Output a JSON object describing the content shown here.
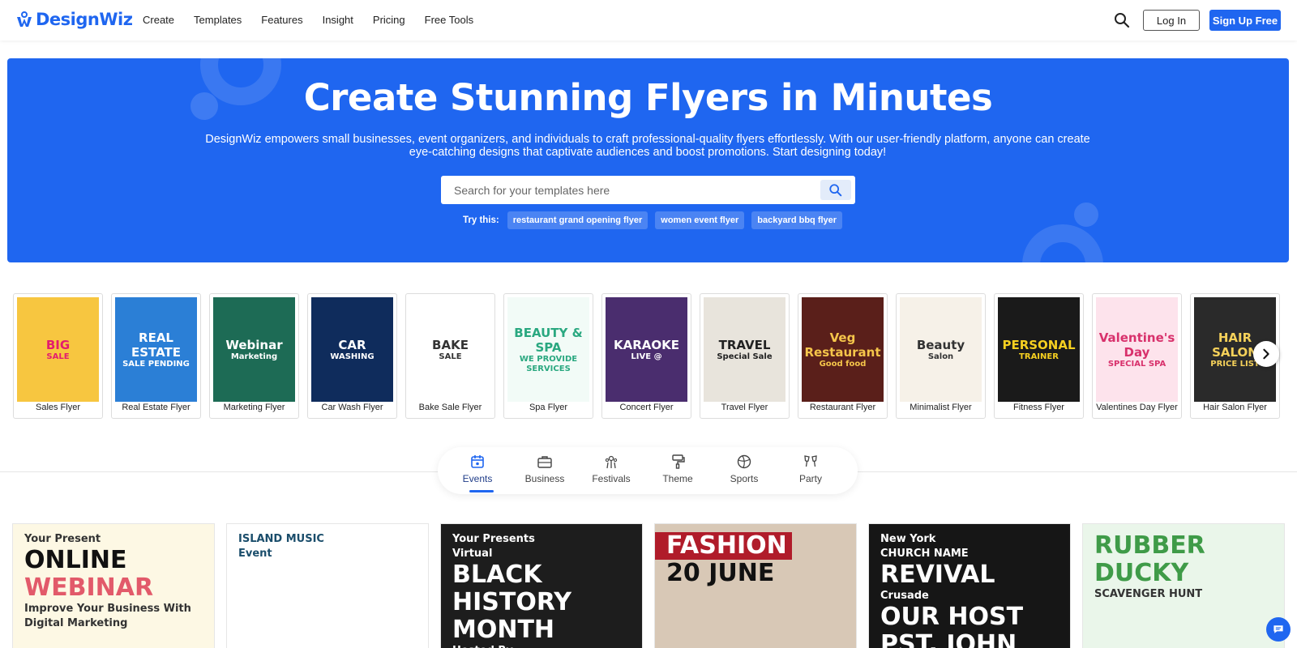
{
  "brand": {
    "name": "DesignWiz"
  },
  "nav": {
    "items": [
      "Create",
      "Templates",
      "Features",
      "Insight",
      "Pricing",
      "Free Tools"
    ],
    "login": "Log In",
    "signup": "Sign Up Free"
  },
  "hero": {
    "title": "Create Stunning Flyers in Minutes",
    "description": "DesignWiz empowers small businesses, event organizers, and individuals to craft professional-quality flyers effortlessly. With our user-friendly platform, anyone can create eye-catching designs that captivate audiences and boost promotions. Start designing today!",
    "search_placeholder": "Search for your templates here",
    "try_label": "Try this:",
    "suggestions": [
      "restaurant grand opening flyer",
      "women event flyer",
      "backyard bbq flyer"
    ]
  },
  "flyer_types": [
    {
      "label": "Sales Flyer",
      "thumb_lines": [
        "BIG",
        "SALE"
      ],
      "bg": "#f7c640",
      "fg": "#e31c6e"
    },
    {
      "label": "Real Estate Flyer",
      "thumb_lines": [
        "REAL ESTATE",
        "SALE PENDING"
      ],
      "bg": "#2b7fd6",
      "fg": "#ffffff"
    },
    {
      "label": "Marketing Flyer",
      "thumb_lines": [
        "Webinar",
        "Marketing"
      ],
      "bg": "#1d6b55",
      "fg": "#ffffff"
    },
    {
      "label": "Car Wash Flyer",
      "thumb_lines": [
        "CAR",
        "WASHING"
      ],
      "bg": "#0f2c5c",
      "fg": "#ffffff"
    },
    {
      "label": "Bake Sale Flyer",
      "thumb_lines": [
        "BAKE",
        "SALE"
      ],
      "bg": "#ffffff",
      "fg": "#333333"
    },
    {
      "label": "Spa Flyer",
      "thumb_lines": [
        "BEAUTY & SPA",
        "WE PROVIDE SERVICES"
      ],
      "bg": "#f2fbf7",
      "fg": "#2aa880"
    },
    {
      "label": "Concert Flyer",
      "thumb_lines": [
        "KARAOKE",
        "LIVE @"
      ],
      "bg": "#4a2d6e",
      "fg": "#ffffff"
    },
    {
      "label": "Travel Flyer",
      "thumb_lines": [
        "TRAVEL",
        "Special Sale"
      ],
      "bg": "#e8e4dc",
      "fg": "#222222"
    },
    {
      "label": "Restaurant Flyer",
      "thumb_lines": [
        "Veg Restaurant",
        "Good food"
      ],
      "bg": "#5a1f1a",
      "fg": "#f5c54a"
    },
    {
      "label": "Minimalist Flyer",
      "thumb_lines": [
        "Beauty",
        "Salon"
      ],
      "bg": "#f6f1e8",
      "fg": "#333333"
    },
    {
      "label": "Fitness Flyer",
      "thumb_lines": [
        "PERSONAL",
        "TRAINER"
      ],
      "bg": "#1a1a1a",
      "fg": "#f6d020"
    },
    {
      "label": "Valentines Day Flyer",
      "thumb_lines": [
        "Valentine's Day",
        "SPECIAL SPA"
      ],
      "bg": "#fde3ec",
      "fg": "#d8316c"
    },
    {
      "label": "Hair Salon Flyer",
      "thumb_lines": [
        "HAIR SALON",
        "PRICE LIST"
      ],
      "bg": "#2a2a2a",
      "fg": "#f5d15a"
    }
  ],
  "category_tabs": [
    {
      "label": "Events",
      "icon": "calendar-icon",
      "active": true
    },
    {
      "label": "Business",
      "icon": "briefcase-icon",
      "active": false
    },
    {
      "label": "Festivals",
      "icon": "fireworks-icon",
      "active": false
    },
    {
      "label": "Theme",
      "icon": "paint-roller-icon",
      "active": false
    },
    {
      "label": "Sports",
      "icon": "sports-balls-icon",
      "active": false
    },
    {
      "label": "Party",
      "icon": "cheers-icon",
      "active": false
    }
  ],
  "templates": [
    {
      "name": "online-webinar",
      "lines": [
        "Your Present",
        "ONLINE",
        "WEBINAR",
        "Improve Your Business With Digital Marketing"
      ],
      "bg": "#fdf8e4"
    },
    {
      "name": "island-music-event",
      "lines": [
        "ISLAND MUSIC",
        "Event"
      ],
      "bg": "#ffffff"
    },
    {
      "name": "black-history-month",
      "lines": [
        "Your Presents",
        "Virtual",
        "BLACK",
        "HISTORY",
        "MONTH",
        "Hosted By"
      ],
      "bg": "#1d1d1d"
    },
    {
      "name": "fashion",
      "lines": [
        "FASHION",
        "20 JUNE"
      ],
      "bg": "#d8c8b6"
    },
    {
      "name": "revival-crusade",
      "lines": [
        "New York",
        "CHURCH NAME",
        "REVIVAL",
        "Crusade",
        "OUR HOST",
        "PST. JOHN"
      ],
      "bg": "#161616"
    },
    {
      "name": "rubber-ducky",
      "lines": [
        "RUBBER",
        "DUCKY",
        "SCAVENGER HUNT"
      ],
      "bg": "#eaf6ea"
    }
  ],
  "colors": {
    "brand_blue": "#1f66f0",
    "text": "#222222"
  }
}
